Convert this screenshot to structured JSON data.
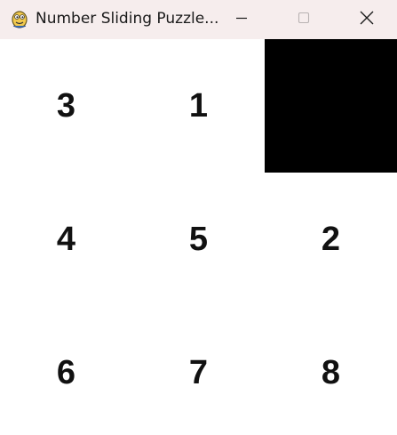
{
  "window": {
    "title": "Number Sliding Puzzle...",
    "app_icon": "pygame-snake-icon",
    "controls": {
      "minimize_icon": "minimize-icon",
      "maximize_icon": "maximize-icon",
      "close_icon": "close-icon"
    }
  },
  "board": {
    "rows": 3,
    "cols": 3,
    "empty_color": "#000000",
    "tiles": [
      {
        "label": "3"
      },
      {
        "label": "1"
      },
      {
        "label": ""
      },
      {
        "label": "4"
      },
      {
        "label": "5"
      },
      {
        "label": "2"
      },
      {
        "label": "6"
      },
      {
        "label": "7"
      },
      {
        "label": "8"
      }
    ]
  }
}
